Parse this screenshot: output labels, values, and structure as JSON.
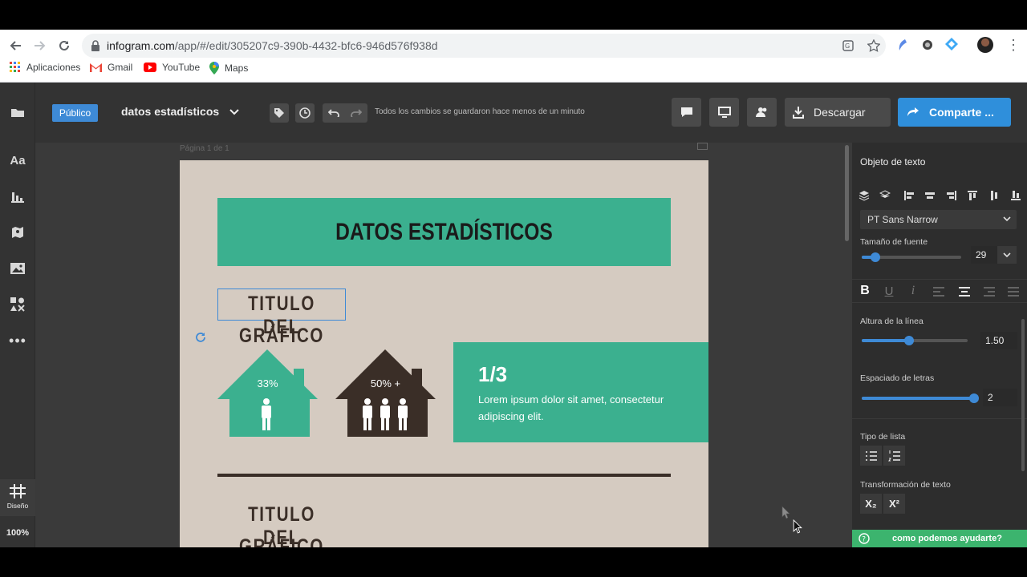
{
  "browser": {
    "url_host": "infogram.com",
    "url_path": "/app/#/edit/305207c9-390b-4432-bfc6-946d576f938d",
    "bookmarks": [
      {
        "label": "Aplicaciones",
        "icon": "apps-grid-icon"
      },
      {
        "label": "Gmail",
        "icon": "gmail-icon"
      },
      {
        "label": "YouTube",
        "icon": "youtube-icon"
      },
      {
        "label": "Maps",
        "icon": "maps-pin-icon"
      }
    ]
  },
  "toolbar": {
    "visibility_badge": "Público",
    "project_title": "datos estadísticos",
    "save_status": "Todos los cambios se guardaron hace menos de un minuto",
    "download_label": "Descargar",
    "share_label": "Comparte ..."
  },
  "left_rail": {
    "items": [
      {
        "name": "folder-icon"
      },
      {
        "name": "text-icon",
        "glyph": "Aa"
      },
      {
        "name": "chart-icon"
      },
      {
        "name": "map-icon"
      },
      {
        "name": "image-icon"
      },
      {
        "name": "shapes-icon"
      },
      {
        "name": "more-icon"
      }
    ],
    "design_label": "Diseño",
    "zoom": "100%"
  },
  "canvas": {
    "page_label": "Página 1 de 1",
    "banner_title": "DATOS ESTADÍSTICOS",
    "section_title_line1": "TITULO DEL",
    "section_title_line2": "GRÁFICO",
    "house1_value": "33%",
    "house2_value": "50% +",
    "stat_fraction": "1/3",
    "stat_text": "Lorem ipsum dolor sit amet, consectetur adipiscing elit.",
    "section2_title_line1": "TITULO DEL",
    "section2_title_line2": "GRÁFICO",
    "colors": {
      "teal": "#3bb08f",
      "dark": "#3a2e27",
      "bg": "#d5cbc1"
    }
  },
  "panel": {
    "title": "Objeto de texto",
    "font_family": "PT Sans Narrow",
    "font_size_label": "Tamaño de fuente",
    "font_size_value": "29",
    "line_height_label": "Altura de la línea",
    "line_height_value": "1.50",
    "letter_spacing_label": "Espaciado de letras",
    "letter_spacing_value": "2",
    "list_type_label": "Tipo de lista",
    "text_transform_label": "Transformación de texto",
    "subscript_label": "X₂",
    "superscript_label": "X²",
    "help_label": "como podemos ayudarte?",
    "font_size_fraction": 0.14,
    "line_height_fraction": 0.45,
    "letter_spacing_fraction": 1.0
  }
}
